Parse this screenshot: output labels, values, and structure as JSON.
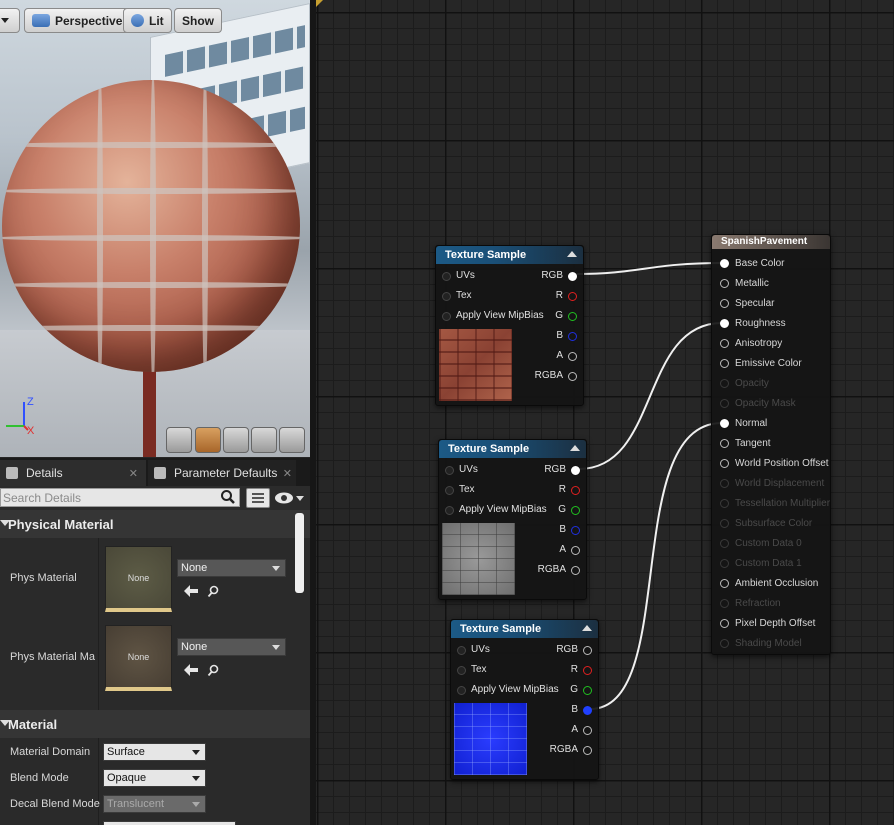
{
  "viewport": {
    "perspective_label": "Perspective",
    "lit_label": "Lit",
    "show_label": "Show",
    "axis_z": "Z",
    "axis_x": "X"
  },
  "details": {
    "tab_details": "Details",
    "tab_parameters": "Parameter Defaults",
    "search_placeholder": "Search Details",
    "physical_material_header": "Physical Material",
    "phys_material_label": "Phys Material",
    "phys_material_value": "None",
    "phys_material_thumb": "None",
    "phys_material_mask_label": "Phys Material Ma",
    "phys_material_mask_value": "None",
    "phys_material_mask_thumb": "None",
    "material_header": "Material",
    "material_domain_label": "Material Domain",
    "material_domain_value": "Surface",
    "blend_mode_label": "Blend Mode",
    "blend_mode_value": "Opaque",
    "decal_blend_label": "Decal Blend Mode",
    "decal_blend_value": "Translucent"
  },
  "nodes": {
    "tex1": {
      "title": "Texture Sample",
      "inputs": [
        "UVs",
        "Tex",
        "Apply View MipBias"
      ],
      "outputs": [
        "RGB",
        "R",
        "G",
        "B",
        "A",
        "RGBA"
      ]
    },
    "tex2": {
      "title": "Texture Sample",
      "inputs": [
        "UVs",
        "Tex",
        "Apply View MipBias"
      ],
      "outputs": [
        "RGB",
        "R",
        "G",
        "B",
        "A",
        "RGBA"
      ]
    },
    "tex3": {
      "title": "Texture Sample",
      "inputs": [
        "UVs",
        "Tex",
        "Apply View MipBias"
      ],
      "outputs": [
        "RGB",
        "R",
        "G",
        "B",
        "A",
        "RGBA"
      ]
    },
    "material": {
      "title": "SpanishPavement",
      "pins": [
        {
          "label": "Base Color",
          "enabled": true,
          "connected": true
        },
        {
          "label": "Metallic",
          "enabled": true,
          "connected": false
        },
        {
          "label": "Specular",
          "enabled": true,
          "connected": false
        },
        {
          "label": "Roughness",
          "enabled": true,
          "connected": true
        },
        {
          "label": "Anisotropy",
          "enabled": true,
          "connected": false
        },
        {
          "label": "Emissive Color",
          "enabled": true,
          "connected": false
        },
        {
          "label": "Opacity",
          "enabled": false,
          "connected": false
        },
        {
          "label": "Opacity Mask",
          "enabled": false,
          "connected": false
        },
        {
          "label": "Normal",
          "enabled": true,
          "connected": true
        },
        {
          "label": "Tangent",
          "enabled": true,
          "connected": false
        },
        {
          "label": "World Position Offset",
          "enabled": true,
          "connected": false
        },
        {
          "label": "World Displacement",
          "enabled": false,
          "connected": false
        },
        {
          "label": "Tessellation Multiplier",
          "enabled": false,
          "connected": false
        },
        {
          "label": "Subsurface Color",
          "enabled": false,
          "connected": false
        },
        {
          "label": "Custom Data 0",
          "enabled": false,
          "connected": false
        },
        {
          "label": "Custom Data 1",
          "enabled": false,
          "connected": false
        },
        {
          "label": "Ambient Occlusion",
          "enabled": true,
          "connected": false
        },
        {
          "label": "Refraction",
          "enabled": false,
          "connected": false
        },
        {
          "label": "Pixel Depth Offset",
          "enabled": true,
          "connected": false
        },
        {
          "label": "Shading Model",
          "enabled": false,
          "connected": false
        }
      ]
    }
  },
  "colors": {
    "node_header": "#1c5a86",
    "graph_bg": "#262626",
    "pin_red": "#e02020",
    "pin_green": "#20c020",
    "pin_blue": "#2030e0"
  }
}
